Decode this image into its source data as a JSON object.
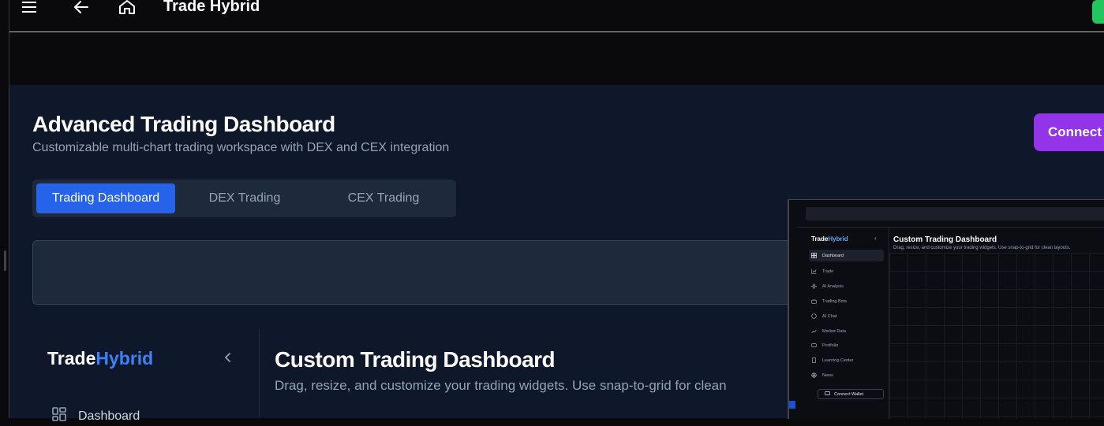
{
  "app": {
    "title": "Trade Hybrid"
  },
  "topbar": {
    "icons": [
      "menu-icon",
      "arrow-left-icon",
      "home-icon"
    ]
  },
  "header": {
    "title": "Advanced Trading Dashboard",
    "subtitle": "Customizable multi-chart trading workspace with DEX and CEX integration",
    "connect_label": "Connect W"
  },
  "tabs": [
    {
      "label": "Trading Dashboard",
      "active": true
    },
    {
      "label": "DEX Trading",
      "active": false
    },
    {
      "label": "CEX Trading",
      "active": false
    }
  ],
  "sidebar": {
    "brand_part1": "Trade",
    "brand_part2": "Hybrid",
    "items": [
      {
        "label": "Dashboard",
        "icon": "grid-icon"
      }
    ]
  },
  "main": {
    "title": "Custom Trading Dashboard",
    "subtitle": "Drag, resize, and customize your trading widgets. Use snap-to-grid for clean"
  },
  "popup": {
    "brand_part1": "Trade",
    "brand_part2": "Hybrid",
    "title": "Custom Trading Dashboard",
    "subtitle": "Drag, resize, and customize your trading widgets. Use snap-to-grid for clean layouts.",
    "nav": [
      {
        "label": "Dashboard",
        "icon": "grid-icon",
        "active": true
      },
      {
        "label": "Trade",
        "icon": "chart-icon",
        "active": false
      },
      {
        "label": "AI Analysis",
        "icon": "sparkle-icon",
        "active": false
      },
      {
        "label": "Trading Bots",
        "icon": "bot-icon",
        "active": false
      },
      {
        "label": "AI Chat",
        "icon": "chat-icon",
        "active": false
      },
      {
        "label": "Market Data",
        "icon": "trend-icon",
        "active": false
      },
      {
        "label": "Portfolio",
        "icon": "wallet-icon",
        "active": false
      },
      {
        "label": "Learning Center",
        "icon": "book-icon",
        "active": false
      },
      {
        "label": "News",
        "icon": "globe-icon",
        "active": false
      }
    ],
    "wallet_label": "Connect Wallet"
  },
  "colors": {
    "accent_blue": "#2563eb",
    "accent_purple": "#9333ea",
    "brand_blue": "#3b82f6",
    "status_green": "#22c55e"
  }
}
